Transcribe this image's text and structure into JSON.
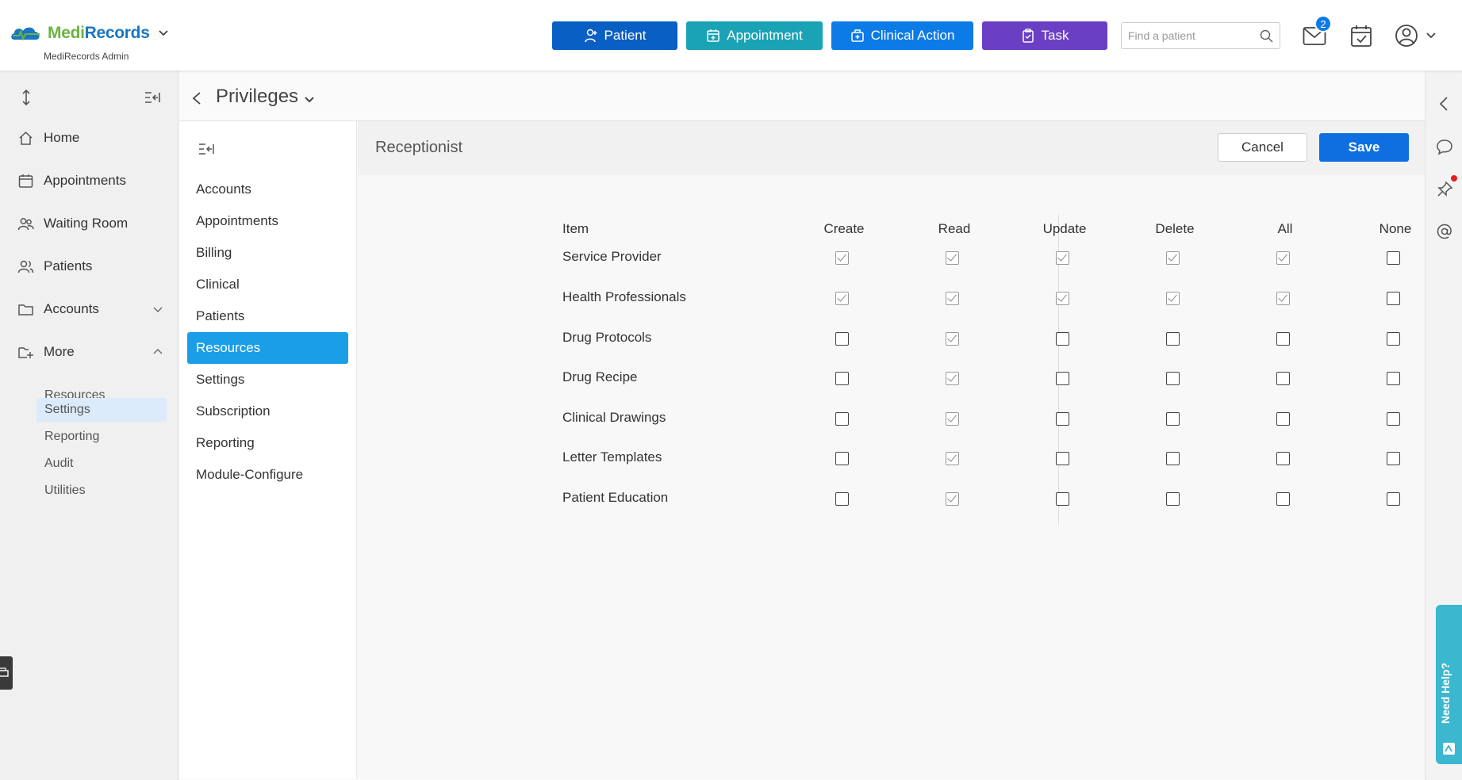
{
  "brand": {
    "name_part1": "Medi",
    "name_part2": "Records",
    "subtitle": "MediRecords Admin"
  },
  "topbar": {
    "buttons": {
      "patient": "Patient",
      "appointment": "Appointment",
      "clinical_action": "Clinical Action",
      "task": "Task"
    },
    "search_placeholder": "Find a patient",
    "mail_badge": "2"
  },
  "sidebar": {
    "items": [
      {
        "label": "Home"
      },
      {
        "label": "Appointments"
      },
      {
        "label": "Waiting Room"
      },
      {
        "label": "Patients"
      },
      {
        "label": "Accounts"
      },
      {
        "label": "More"
      }
    ],
    "sub_items": [
      "Resources",
      "Settings",
      "Reporting",
      "Audit",
      "Utilities"
    ],
    "active_sub": "Settings"
  },
  "page": {
    "title": "Privileges"
  },
  "subnav": {
    "items": [
      "Accounts",
      "Appointments",
      "Billing",
      "Clinical",
      "Patients",
      "Resources",
      "Settings",
      "Subscription",
      "Reporting",
      "Module-Configure"
    ],
    "active": "Resources"
  },
  "content": {
    "role": "Receptionist",
    "cancel_label": "Cancel",
    "save_label": "Save",
    "columns": [
      "Item",
      "Create",
      "Read",
      "Update",
      "Delete",
      "All",
      "None"
    ],
    "rows": [
      {
        "item": "Service Provider",
        "create": true,
        "read": true,
        "update": true,
        "delete": true,
        "all": true,
        "none": false
      },
      {
        "item": "Health Professionals",
        "create": true,
        "read": true,
        "update": true,
        "delete": true,
        "all": true,
        "none": false
      },
      {
        "item": "Drug Protocols",
        "create": false,
        "read": true,
        "update": false,
        "delete": false,
        "all": false,
        "none": false
      },
      {
        "item": "Drug Recipe",
        "create": false,
        "read": true,
        "update": false,
        "delete": false,
        "all": false,
        "none": false
      },
      {
        "item": "Clinical Drawings",
        "create": false,
        "read": true,
        "update": false,
        "delete": false,
        "all": false,
        "none": false
      },
      {
        "item": "Letter Templates",
        "create": false,
        "read": true,
        "update": false,
        "delete": false,
        "all": false,
        "none": false
      },
      {
        "item": "Patient Education",
        "create": false,
        "read": true,
        "update": false,
        "delete": false,
        "all": false,
        "none": false
      }
    ]
  },
  "help": {
    "label": "Need Help?"
  },
  "colors": {
    "primary": "#0d6fe0",
    "active_nav": "#1a9ee8",
    "teal": "#1aa3b4",
    "purple": "#6a3fc4"
  }
}
